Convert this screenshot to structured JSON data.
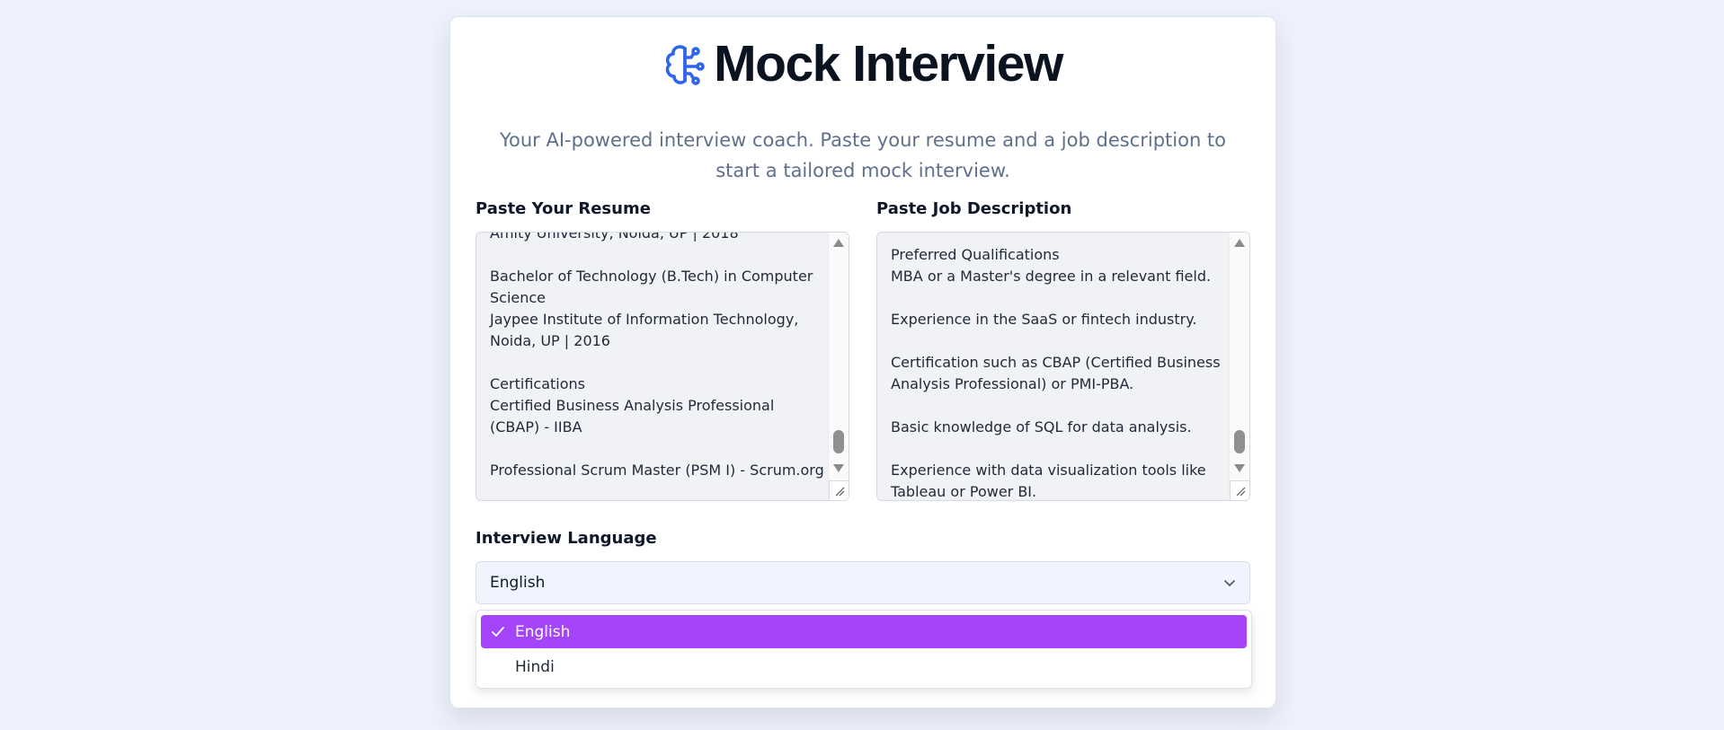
{
  "app": {
    "title": "Mock Interview",
    "subtitle": "Your AI-powered interview coach. Paste your resume and a job description to start a tailored mock interview.",
    "icon": "brain-icon",
    "accent_color": "#2f64ec"
  },
  "resume": {
    "label": "Paste Your Resume",
    "text": "Amity University, Noida, UP | 2018\n\nBachelor of Technology (B.Tech) in Computer Science\nJaypee Institute of Information Technology, Noida, UP | 2016\n\nCertifications\nCertified Business Analysis Professional (CBAP) - IIBA\n\nProfessional Scrum Master (PSM I) - Scrum.org"
  },
  "job_description": {
    "label": "Paste Job Description",
    "text": "Preferred Qualifications\nMBA or a Master's degree in a relevant field.\n\nExperience in the SaaS or fintech industry.\n\nCertification such as CBAP (Certified Business Analysis Professional) or PMI-PBA.\n\nBasic knowledge of SQL for data analysis.\n\nExperience with data visualization tools like Tableau or Power BI."
  },
  "language": {
    "label": "Interview Language",
    "selected": "English",
    "options": [
      {
        "label": "English",
        "selected": true
      },
      {
        "label": "Hindi",
        "selected": false
      }
    ],
    "highlight_color": "#a545fb"
  }
}
